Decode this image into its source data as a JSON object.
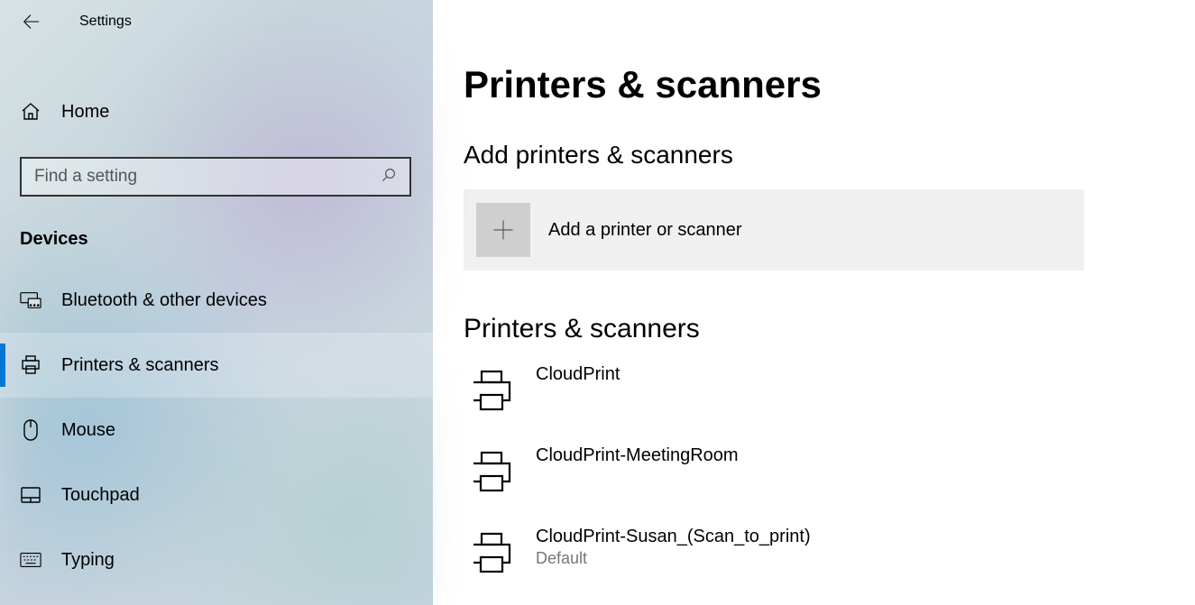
{
  "header": {
    "app_title": "Settings"
  },
  "sidebar": {
    "home_label": "Home",
    "search_placeholder": "Find a setting",
    "section_title": "Devices",
    "items": [
      {
        "label": "Bluetooth & other devices"
      },
      {
        "label": "Printers & scanners"
      },
      {
        "label": "Mouse"
      },
      {
        "label": "Touchpad"
      },
      {
        "label": "Typing"
      }
    ]
  },
  "main": {
    "page_title": "Printers & scanners",
    "add_section_title": "Add printers & scanners",
    "add_button_label": "Add a printer or scanner",
    "list_section_title": "Printers & scanners",
    "printers": [
      {
        "name": "CloudPrint",
        "sub": ""
      },
      {
        "name": "CloudPrint-MeetingRoom",
        "sub": ""
      },
      {
        "name": "CloudPrint-Susan_(Scan_to_print)",
        "sub": "Default"
      }
    ]
  }
}
